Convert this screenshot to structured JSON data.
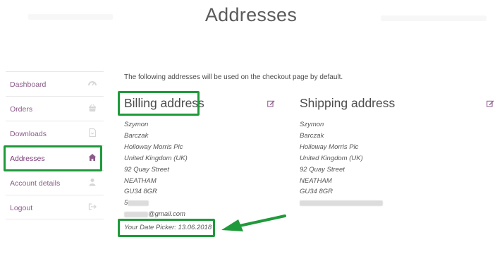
{
  "page": {
    "title": "Addresses"
  },
  "nav": {
    "items": [
      {
        "label": "Dashboard",
        "icon": "dashboard-icon",
        "active": false
      },
      {
        "label": "Orders",
        "icon": "basket-icon",
        "active": false
      },
      {
        "label": "Downloads",
        "icon": "file-icon",
        "active": false
      },
      {
        "label": "Addresses",
        "icon": "home-icon",
        "active": true
      },
      {
        "label": "Account details",
        "icon": "user-icon",
        "active": false
      },
      {
        "label": "Logout",
        "icon": "sign-out-icon",
        "active": false
      }
    ]
  },
  "content": {
    "intro": "The following addresses will be used on the checkout page by default.",
    "billing": {
      "title": "Billing address",
      "lines": [
        "Szymon",
        "Barczak",
        "Holloway Morris Plc",
        "United Kingdom (UK)",
        "92 Quay Street",
        "NEATHAM",
        "GU34 8GR"
      ],
      "phone_prefix": "5",
      "email_suffix": "@gmail.com",
      "date_picker": "Your Date Picker: 13.06.2018"
    },
    "shipping": {
      "title": "Shipping address",
      "lines": [
        "Szymon",
        "Barczak",
        "Holloway Morris Plc",
        "United Kingdom (UK)",
        "92 Quay Street",
        "NEATHAM",
        "GU34 8GR"
      ]
    }
  },
  "colors": {
    "highlight": "#1f9a3b",
    "link": "#8b5a8a",
    "edit_icon": "#8b5a8a"
  }
}
